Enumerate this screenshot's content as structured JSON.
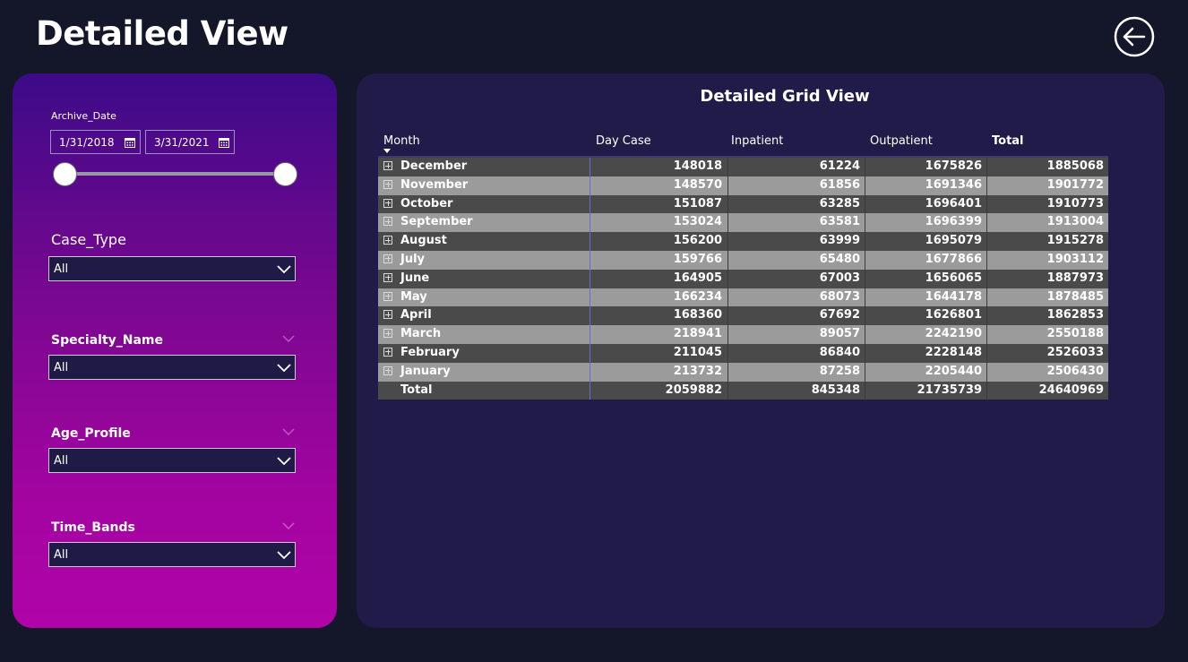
{
  "page": {
    "title": "Detailed View"
  },
  "back_button": {
    "icon": "back-arrow-icon"
  },
  "filters": {
    "archive_date": {
      "label": "Archive_Date",
      "start": "1/31/2018",
      "end": "3/31/2021"
    },
    "case_type": {
      "label": "Case_Type",
      "value": "All"
    },
    "specialty_name": {
      "label": "Specialty_Name",
      "value": "All"
    },
    "age_profile": {
      "label": "Age_Profile",
      "value": "All"
    },
    "time_bands": {
      "label": "Time_Bands",
      "value": "All"
    }
  },
  "grid": {
    "title": "Detailed Grid View",
    "columns": [
      "Month",
      "Day Case",
      "Inpatient",
      "Outpatient",
      "Total"
    ],
    "rows": [
      {
        "month": "December",
        "day_case": "148018",
        "inpatient": "61224",
        "outpatient": "1675826",
        "total": "1885068"
      },
      {
        "month": "November",
        "day_case": "148570",
        "inpatient": "61856",
        "outpatient": "1691346",
        "total": "1901772"
      },
      {
        "month": "October",
        "day_case": "151087",
        "inpatient": "63285",
        "outpatient": "1696401",
        "total": "1910773"
      },
      {
        "month": "September",
        "day_case": "153024",
        "inpatient": "63581",
        "outpatient": "1696399",
        "total": "1913004"
      },
      {
        "month": "August",
        "day_case": "156200",
        "inpatient": "63999",
        "outpatient": "1695079",
        "total": "1915278"
      },
      {
        "month": "July",
        "day_case": "159766",
        "inpatient": "65480",
        "outpatient": "1677866",
        "total": "1903112"
      },
      {
        "month": "June",
        "day_case": "164905",
        "inpatient": "67003",
        "outpatient": "1656065",
        "total": "1887973"
      },
      {
        "month": "May",
        "day_case": "166234",
        "inpatient": "68073",
        "outpatient": "1644178",
        "total": "1878485"
      },
      {
        "month": "April",
        "day_case": "168360",
        "inpatient": "67692",
        "outpatient": "1626801",
        "total": "1862853"
      },
      {
        "month": "March",
        "day_case": "218941",
        "inpatient": "89057",
        "outpatient": "2242190",
        "total": "2550188"
      },
      {
        "month": "February",
        "day_case": "211045",
        "inpatient": "86840",
        "outpatient": "2228148",
        "total": "2526033"
      },
      {
        "month": "January",
        "day_case": "213732",
        "inpatient": "87258",
        "outpatient": "2205440",
        "total": "2506430"
      }
    ],
    "total_row": {
      "month": "Total",
      "day_case": "2059882",
      "inpatient": "845348",
      "outpatient": "21735739",
      "total": "24640969"
    }
  },
  "colors": {
    "background": "#14172a",
    "panel": "#211b4a",
    "row_dark": "#4a4a4a",
    "row_light": "#9b9b9b"
  }
}
